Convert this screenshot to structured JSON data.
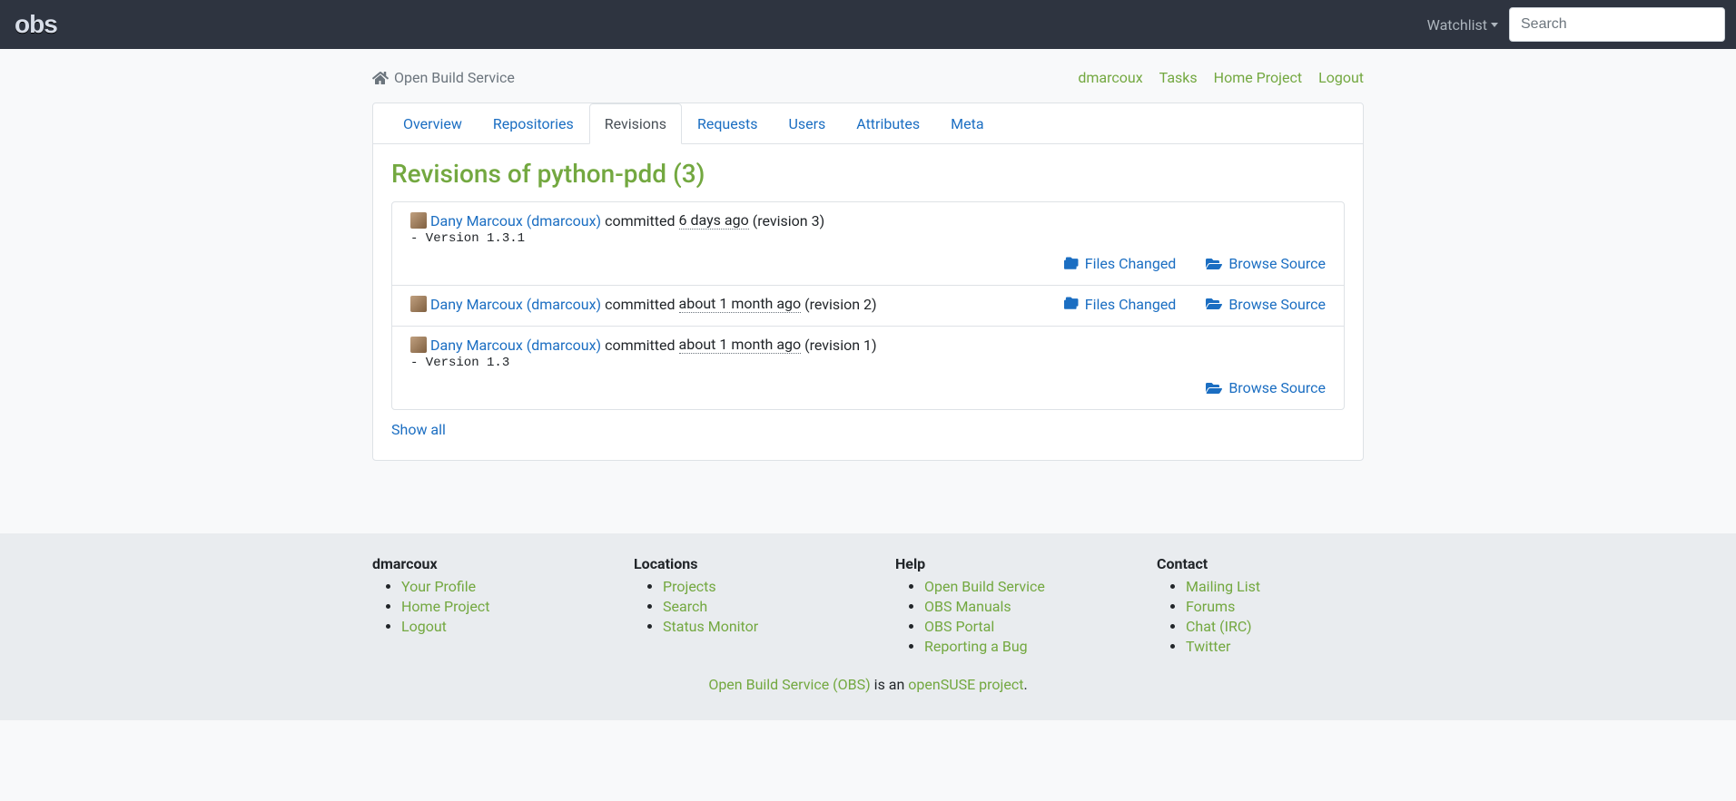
{
  "navbar": {
    "logo": "obs",
    "watchlist_label": "Watchlist",
    "search_placeholder": "Search"
  },
  "breadcrumb": {
    "home_label": "Open Build Service"
  },
  "usernav": {
    "items": [
      "dmarcoux",
      "Tasks",
      "Home Project",
      "Logout"
    ]
  },
  "tabs": {
    "items": [
      "Overview",
      "Repositories",
      "Revisions",
      "Requests",
      "Users",
      "Attributes",
      "Meta"
    ],
    "active_index": 2
  },
  "page": {
    "title": "Revisions of python-pdd (3)",
    "show_all_label": "Show all"
  },
  "revisions": [
    {
      "author": "Dany Marcoux (dmarcoux)",
      "committed_word": "committed",
      "timestamp": "6 days ago",
      "revision_label": "(revision 3)",
      "message": "- Version 1.3.1",
      "files_changed": true,
      "browse_source": true
    },
    {
      "author": "Dany Marcoux (dmarcoux)",
      "committed_word": "committed",
      "timestamp": "about 1 month ago",
      "revision_label": "(revision 2)",
      "message": "",
      "files_changed": true,
      "browse_source": true
    },
    {
      "author": "Dany Marcoux (dmarcoux)",
      "committed_word": "committed",
      "timestamp": "about 1 month ago",
      "revision_label": "(revision 1)",
      "message": "- Version 1.3",
      "files_changed": false,
      "browse_source": true
    }
  ],
  "actions": {
    "files_changed_label": "Files Changed",
    "browse_source_label": "Browse Source"
  },
  "footer": {
    "cols": [
      {
        "title": "dmarcoux",
        "links": [
          "Your Profile",
          "Home Project",
          "Logout"
        ]
      },
      {
        "title": "Locations",
        "links": [
          "Projects",
          "Search",
          "Status Monitor"
        ]
      },
      {
        "title": "Help",
        "links": [
          "Open Build Service",
          "OBS Manuals",
          "OBS Portal",
          "Reporting a Bug"
        ]
      },
      {
        "title": "Contact",
        "links": [
          "Mailing List",
          "Forums",
          "Chat (IRC)",
          "Twitter"
        ]
      }
    ],
    "tagline_1": "Open Build Service (OBS)",
    "tagline_mid": " is an ",
    "tagline_2": "openSUSE project",
    "tagline_end": "."
  }
}
